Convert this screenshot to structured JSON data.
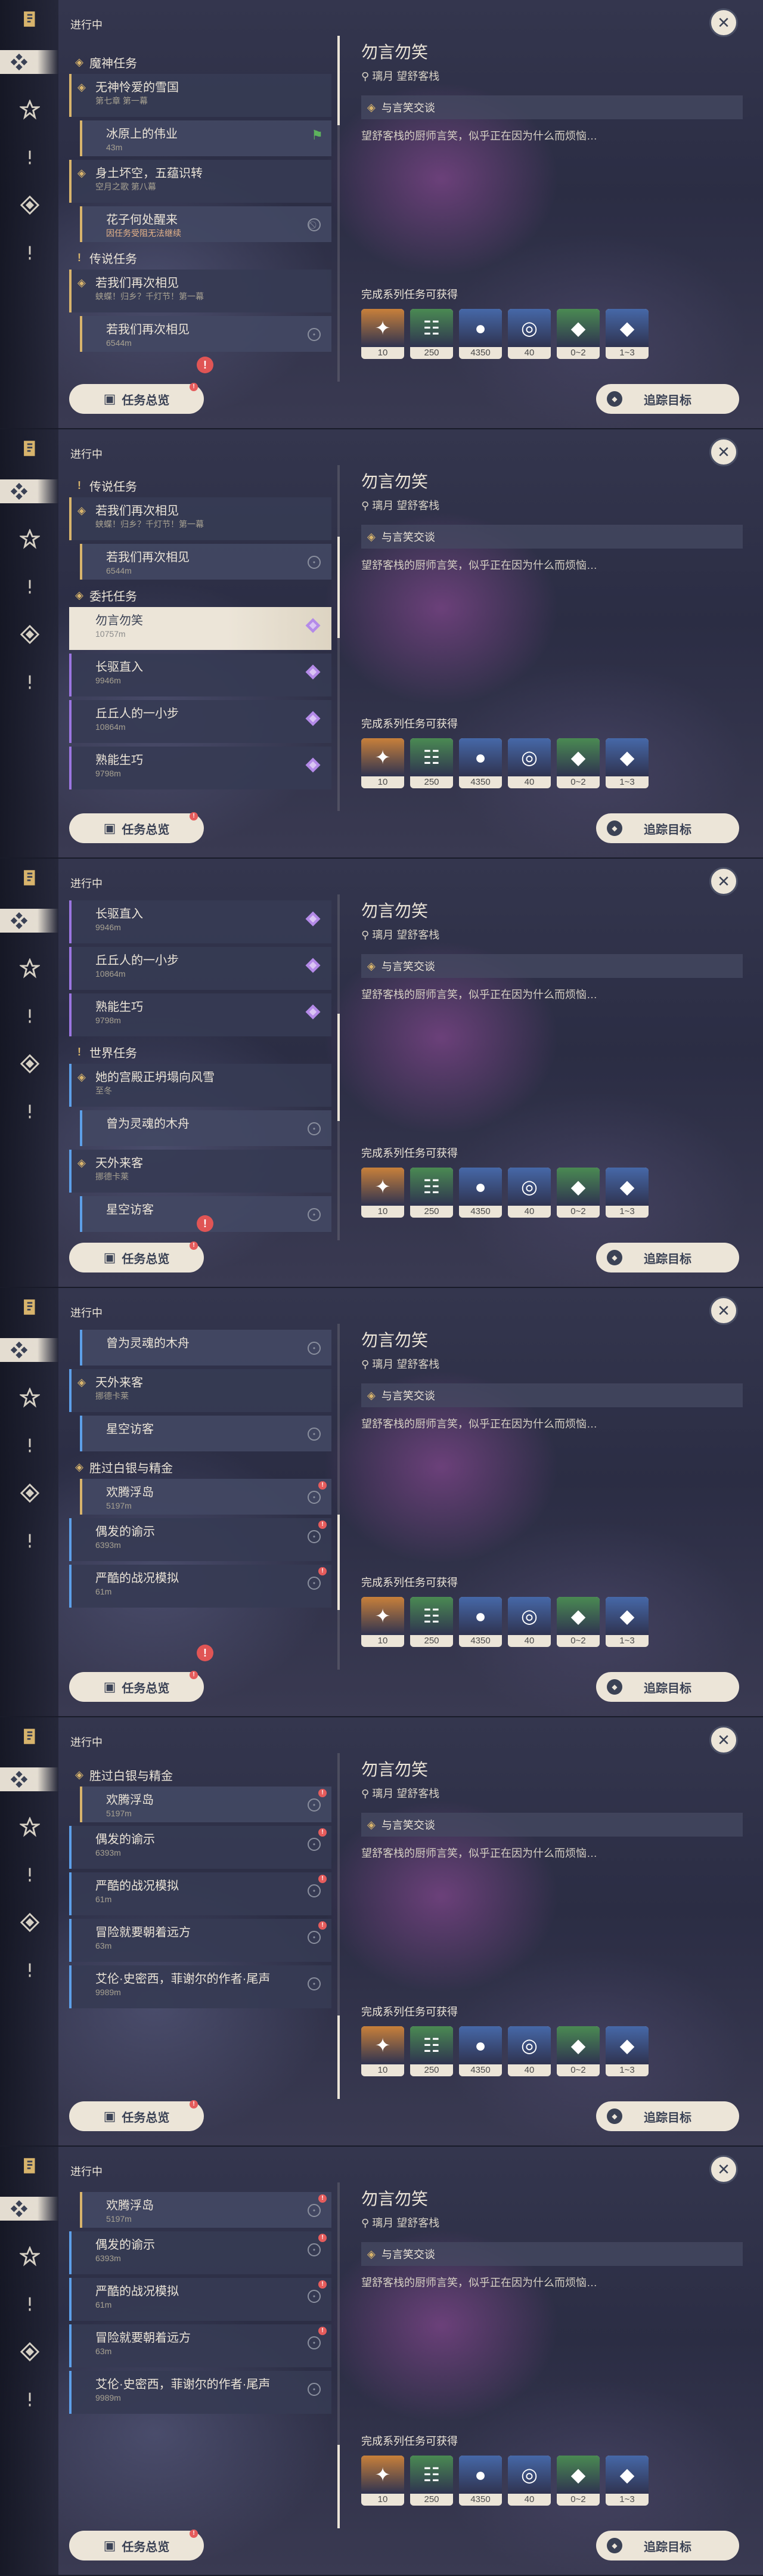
{
  "ui": {
    "header": "进行中",
    "overview_label": "任务总览",
    "track_label": "追踪目标",
    "selected_title": "勿言勿笑",
    "selected_region": "璃月",
    "selected_place": "望舒客栈",
    "objective": "与言笑交谈",
    "description": "望舒客栈的厨师言笑，似乎正在因为什么而烦恼…",
    "rewards_label": "完成系列任务可获得"
  },
  "colors": {
    "accent": "#d8b46c",
    "world": "#5d9fe8",
    "commission": "#9b76e0",
    "panel": "#ece5d8"
  },
  "rewards": [
    {
      "icon": "primogem-icon",
      "count": "10",
      "color": "#c8803a"
    },
    {
      "icon": "adventure-exp-icon",
      "count": "250",
      "color": "#4a8a52"
    },
    {
      "icon": "mora-icon",
      "count": "4350",
      "color": "#4668a8"
    },
    {
      "icon": "companionship-exp-icon",
      "count": "40",
      "color": "#4668a8"
    },
    {
      "icon": "crystal-shard-icon",
      "count": "0~2",
      "color": "#4a8a52"
    },
    {
      "icon": "pink-crystal-icon",
      "count": "1~3",
      "color": "#4668a8"
    }
  ],
  "screens": [
    {
      "items": [
        {
          "kind": "cat",
          "label": "魔神任务",
          "icon": "archon-icon"
        },
        {
          "kind": "quest",
          "title": "无神怜爱的雪国",
          "sub": "第七章 第一幕",
          "color": "gold",
          "mark": "◈"
        },
        {
          "kind": "sub",
          "title": "冰原上的伟业",
          "sub": "43m",
          "color": "gold",
          "flag": true
        },
        {
          "kind": "quest",
          "title": "身土坏空，五蕴识转",
          "sub": "空月之歌 第八幕",
          "color": "gold",
          "mark": "◈"
        },
        {
          "kind": "sub",
          "title": "花子何处醒来",
          "sub": "因任务受阻无法继续",
          "color": "gold",
          "red": true,
          "pin": "block"
        },
        {
          "kind": "cat",
          "label": "传说任务",
          "icon": "legend-icon"
        },
        {
          "kind": "quest",
          "title": "若我们再次相见",
          "sub": "蛱蝶！归乡？千灯节！第一幕",
          "color": "gold",
          "mark": "◈"
        },
        {
          "kind": "sub",
          "title": "若我们再次相见",
          "sub": "6544m",
          "color": "gold",
          "pin": "loc"
        }
      ]
    },
    {
      "items": [
        {
          "kind": "cat",
          "label": "传说任务",
          "icon": "legend-icon"
        },
        {
          "kind": "quest",
          "title": "若我们再次相见",
          "sub": "蛱蝶！归乡？千灯节！第一幕",
          "color": "gold",
          "mark": "◈"
        },
        {
          "kind": "sub",
          "title": "若我们再次相见",
          "sub": "6544m",
          "color": "gold",
          "pin": "loc"
        },
        {
          "kind": "cat",
          "label": "委托任务",
          "icon": "commission-icon"
        },
        {
          "kind": "sel",
          "title": "勿言勿笑",
          "sub": "10757m",
          "color": "commission",
          "ric": true
        },
        {
          "kind": "plain",
          "title": "长驱直入",
          "sub": "9946m",
          "color": "commission",
          "ric": true
        },
        {
          "kind": "plain",
          "title": "丘丘人的一小步",
          "sub": "10864m",
          "color": "commission",
          "ric": true
        },
        {
          "kind": "plain",
          "title": "熟能生巧",
          "sub": "9798m",
          "color": "commission",
          "ric": true
        }
      ]
    },
    {
      "items": [
        {
          "kind": "plain",
          "title": "长驱直入",
          "sub": "9946m",
          "color": "commission",
          "ric": true
        },
        {
          "kind": "plain",
          "title": "丘丘人的一小步",
          "sub": "10864m",
          "color": "commission",
          "ric": true
        },
        {
          "kind": "plain",
          "title": "熟能生巧",
          "sub": "9798m",
          "color": "commission",
          "ric": true
        },
        {
          "kind": "cat",
          "label": "世界任务",
          "icon": "world-icon"
        },
        {
          "kind": "quest",
          "title": "她的宫殿正坍塌向风雪",
          "sub": "至冬",
          "color": "world",
          "mark": "◈"
        },
        {
          "kind": "sub",
          "title": "曾为灵魂的木舟",
          "sub": "",
          "color": "world",
          "pin": "loc"
        },
        {
          "kind": "quest",
          "title": "天外来客",
          "sub": "挪德卡莱",
          "color": "world",
          "mark": "◈"
        },
        {
          "kind": "sub",
          "title": "星空访客",
          "sub": "",
          "color": "world",
          "pin": "loc"
        }
      ]
    },
    {
      "items": [
        {
          "kind": "sub",
          "title": "曾为灵魂的木舟",
          "sub": "",
          "color": "world",
          "pin": "loc"
        },
        {
          "kind": "quest",
          "title": "天外来客",
          "sub": "挪德卡莱",
          "color": "world",
          "mark": "◈"
        },
        {
          "kind": "sub",
          "title": "星空访客",
          "sub": "",
          "color": "world",
          "pin": "loc"
        },
        {
          "kind": "cat",
          "label": "胜过白银与精金",
          "icon": "event-icon"
        },
        {
          "kind": "sub",
          "title": "欢腾浮岛",
          "sub": "5197m",
          "color": "gold",
          "pin": "loc",
          "dot": true
        },
        {
          "kind": "plain",
          "title": "偶发的谕示",
          "sub": "6393m",
          "color": "world",
          "pin": "loc",
          "dot": true
        },
        {
          "kind": "plain",
          "title": "严酷的战况模拟",
          "sub": "61m",
          "color": "world",
          "pin": "loc",
          "dot": true
        }
      ]
    },
    {
      "items": [
        {
          "kind": "cat",
          "label": "胜过白银与精金",
          "icon": "event-icon"
        },
        {
          "kind": "sub",
          "title": "欢腾浮岛",
          "sub": "5197m",
          "color": "gold",
          "pin": "loc",
          "dot": true
        },
        {
          "kind": "plain",
          "title": "偶发的谕示",
          "sub": "6393m",
          "color": "world",
          "pin": "loc",
          "dot": true
        },
        {
          "kind": "plain",
          "title": "严酷的战况模拟",
          "sub": "61m",
          "color": "world",
          "pin": "loc",
          "dot": true
        },
        {
          "kind": "plain",
          "title": "冒险就要朝着远方",
          "sub": "63m",
          "color": "world",
          "pin": "loc",
          "dot": true
        },
        {
          "kind": "plain",
          "title": "艾伦·史密西，菲谢尔的作者·尾声",
          "sub": "9989m",
          "color": "world",
          "pin": "loc"
        }
      ]
    },
    {
      "items": [
        {
          "kind": "sub",
          "title": "欢腾浮岛",
          "sub": "5197m",
          "color": "gold",
          "pin": "loc",
          "dot": true
        },
        {
          "kind": "plain",
          "title": "偶发的谕示",
          "sub": "6393m",
          "color": "world",
          "pin": "loc",
          "dot": true
        },
        {
          "kind": "plain",
          "title": "严酷的战况模拟",
          "sub": "61m",
          "color": "world",
          "pin": "loc",
          "dot": true
        },
        {
          "kind": "plain",
          "title": "冒险就要朝着远方",
          "sub": "63m",
          "color": "world",
          "pin": "loc",
          "dot": true
        },
        {
          "kind": "plain",
          "title": "艾伦·史密西，菲谢尔的作者·尾声",
          "sub": "9989m",
          "color": "world",
          "pin": "loc"
        }
      ]
    }
  ]
}
